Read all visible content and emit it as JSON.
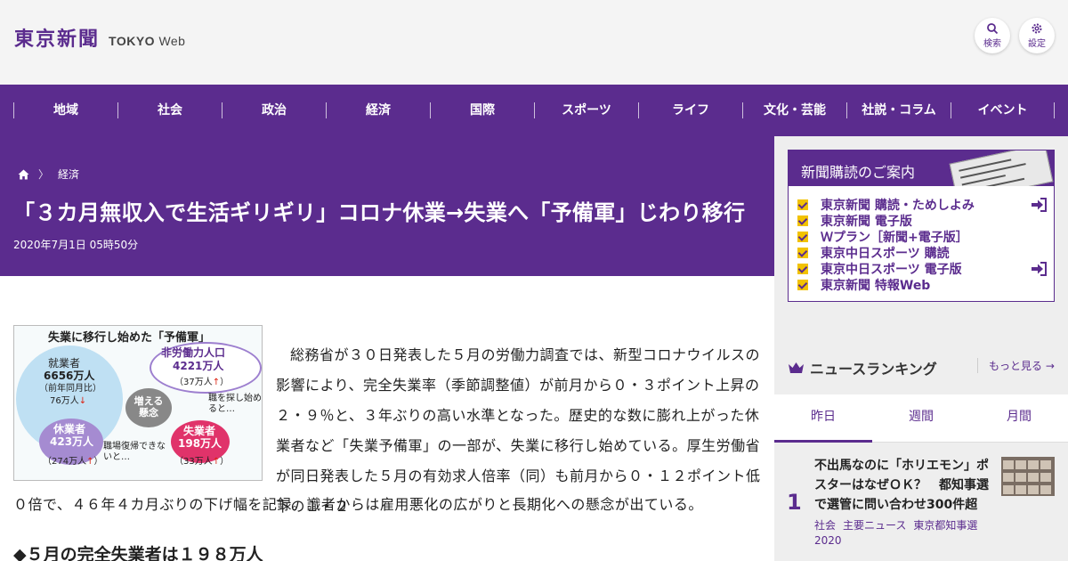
{
  "header": {
    "logo_jp": "東京新聞",
    "logo_en_bold": "TOKYO",
    "logo_en": "Web",
    "search_label": "検索",
    "settings_label": "設定"
  },
  "nav": {
    "items": [
      "地域",
      "社会",
      "政治",
      "経済",
      "国際",
      "スポーツ",
      "ライフ",
      "文化・芸能",
      "社説・コラム",
      "イベント"
    ]
  },
  "breadcrumb": {
    "home_icon": "home-icon",
    "section": "経済"
  },
  "article": {
    "title": "「３カ月無収入で生活ギリギリ」コロナ休業→失業へ「予備軍」じわり移行",
    "date": "2020年7月1日 05時50分",
    "paragraph1": "総務省が３０日発表した５月の労働力調査では、新型コロナウイルスの影響により、完全失業率（季節調整値）が前月から０・３ポイント上昇の２・９％と、３年ぶりの高い水準となった。歴史的な数に膨れ上がった休業者など「失業予備軍」の一部が、失業に移行し始めている。厚生労働省が同日発表した５月の有効求人倍率（同）も前月から０・１２ポイント低下の１・２",
    "paragraph1_last": "０倍で、４６年４カ月ぶりの下げ幅を記録。識者からは雇用悪化の広がりと長期化への懸念が出ている。",
    "subhead": "◆５月の完全失業者は１９８万人"
  },
  "figure": {
    "title": "失業に移行し始めた「予備軍」",
    "employed_label": "就業者",
    "employed_value": "6656万人",
    "employed_yoy_label": "（前年同月比）",
    "employed_yoy": "76万人",
    "nonlabor_label": "非労働力人口",
    "nonlabor_value": "4221万人",
    "nonlabor_yoy": "（37万人",
    "furlough_label": "休業者",
    "furlough_value": "423万人",
    "furlough_yoy": "（274万人",
    "concern_label": "増える懸念",
    "search_note": "職を探し始めると…",
    "return_note": "職場復帰できないと…",
    "unemployed_label": "失業者",
    "unemployed_value": "198万人",
    "unemployed_yoy": "（33万人"
  },
  "sidebar": {
    "subscribe_title": "新聞購読のご案内",
    "subscribe_items": [
      "東京新聞 購読・ためしよみ",
      "東京新聞 電子版",
      "Ｗプラン［新聞+電子版］",
      "東京中日スポーツ 購読",
      "東京中日スポーツ 電子版",
      "東京新聞 特報Web"
    ],
    "ranking_title": "ニュースランキング",
    "ranking_more": "もっと見る",
    "tabs": [
      "昨日",
      "週間",
      "月間"
    ],
    "rank1_num": "1",
    "rank1_title": "不出馬なのに「ホリエモン」ポスターはなぜＯＫ？　都知事選で選管に問い合わせ300件超",
    "rank1_tags": [
      "社会",
      "主要ニュース",
      "東京都知事選2020"
    ]
  },
  "colors": {
    "brand": "#5b2c8e",
    "check": "#f2c200"
  }
}
